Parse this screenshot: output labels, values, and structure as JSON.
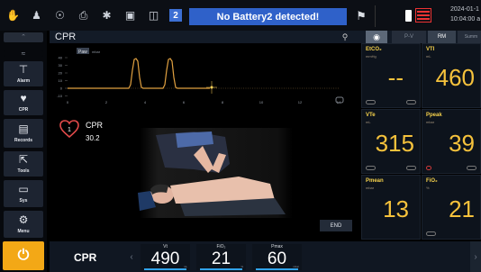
{
  "topbar": {
    "icons": [
      "hand-icon",
      "person-icon",
      "shield-icon",
      "printer-icon",
      "freeze-icon",
      "lock-icon",
      "trash-icon"
    ],
    "battery_number": "2",
    "alarm_message": "No Battery2 detected!",
    "date": "2024-01-1",
    "time": "10:04:00 a"
  },
  "sidebar": {
    "items": [
      {
        "label": "Alarm",
        "icon": "alarm-icon"
      },
      {
        "label": "CPR",
        "icon": "heart-icon"
      },
      {
        "label": "Records",
        "icon": "records-icon"
      },
      {
        "label": "Tools",
        "icon": "wrench-icon"
      },
      {
        "label": "Sys",
        "icon": "monitor-icon"
      },
      {
        "label": "Menu",
        "icon": "gear-icon"
      }
    ]
  },
  "header": {
    "title": "CPR",
    "pv_label": "P-V",
    "rm_label": "RM",
    "summary_label": "Summ"
  },
  "waveform": {
    "tag_paw": "Paw",
    "tag_unit": "mbar",
    "y_ticks": [
      "40",
      "30",
      "20",
      "10",
      "0",
      "-10"
    ],
    "x_ticks": [
      "0",
      "2",
      "4",
      "6",
      "8",
      "10",
      "12",
      "14"
    ]
  },
  "cpr_info": {
    "label": "CPR",
    "value": "30.2",
    "cycle": "1",
    "end_label": "END"
  },
  "params": [
    {
      "name": "EtCO₂",
      "unit": "mmHg",
      "value": "--"
    },
    {
      "name": "VTI",
      "unit": "mL",
      "value": "460"
    },
    {
      "name": "VTe",
      "unit": "mL",
      "value": "315"
    },
    {
      "name": "Ppeak",
      "unit": "mbar",
      "value": "39"
    },
    {
      "name": "Pmean",
      "unit": "mbar",
      "value": "13"
    },
    {
      "name": "FiO₂",
      "unit": "%",
      "value": "21"
    }
  ],
  "bottombar": {
    "mode": "CPR",
    "params": [
      {
        "name": "Vt",
        "value": "490",
        "unit": "mL"
      },
      {
        "name": "FiO₂",
        "value": "21",
        "unit": "%"
      },
      {
        "name": "Pmax",
        "value": "60",
        "unit": "mbar"
      }
    ]
  },
  "colors": {
    "accent_blue": "#2f61c9",
    "param_yellow": "#f6c23c",
    "power_orange": "#f3a816",
    "wave_orange": "#e0a040"
  }
}
